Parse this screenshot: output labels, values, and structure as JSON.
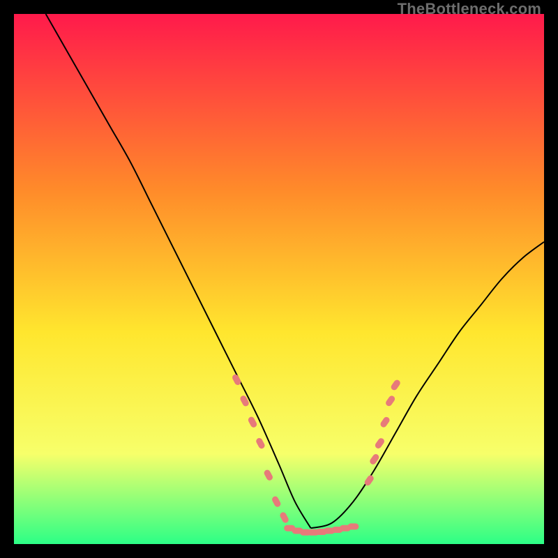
{
  "watermark": "TheBottleneck.com",
  "colors": {
    "gradient_top": "#ff1a4b",
    "gradient_mid1": "#ff8a2a",
    "gradient_mid2": "#ffe62e",
    "gradient_mid3": "#f7ff6a",
    "gradient_bottom": "#2cff86",
    "curve": "#000000",
    "scatter": "#e77a7a",
    "frame": "#000000"
  },
  "chart_data": {
    "type": "line",
    "title": "",
    "xlabel": "",
    "ylabel": "",
    "xlim": [
      0,
      100
    ],
    "ylim": [
      0,
      100
    ],
    "grid": false,
    "legend": false,
    "series": [
      {
        "name": "bottleneck-curve-left",
        "x": [
          6,
          10,
          14,
          18,
          22,
          26,
          30,
          34,
          38,
          42,
          46,
          50,
          53,
          56
        ],
        "values": [
          100,
          93,
          86,
          79,
          72,
          64,
          56,
          48,
          40,
          32,
          24,
          15,
          8,
          3
        ]
      },
      {
        "name": "bottleneck-curve-right",
        "x": [
          56,
          60,
          64,
          68,
          72,
          76,
          80,
          84,
          88,
          92,
          96,
          100
        ],
        "values": [
          3,
          4,
          8,
          14,
          21,
          28,
          34,
          40,
          45,
          50,
          54,
          57
        ]
      }
    ],
    "scatter": {
      "name": "optimal-range-markers",
      "points": [
        {
          "x": 42,
          "y": 31
        },
        {
          "x": 43.5,
          "y": 27
        },
        {
          "x": 45,
          "y": 23
        },
        {
          "x": 46.5,
          "y": 19
        },
        {
          "x": 48,
          "y": 13
        },
        {
          "x": 49.5,
          "y": 8
        },
        {
          "x": 51,
          "y": 5
        },
        {
          "x": 52,
          "y": 3
        },
        {
          "x": 53.5,
          "y": 2.5
        },
        {
          "x": 55,
          "y": 2.2
        },
        {
          "x": 56.5,
          "y": 2.2
        },
        {
          "x": 58,
          "y": 2.3
        },
        {
          "x": 59.5,
          "y": 2.5
        },
        {
          "x": 61,
          "y": 2.7
        },
        {
          "x": 62.5,
          "y": 3
        },
        {
          "x": 64,
          "y": 3.3
        },
        {
          "x": 67,
          "y": 12
        },
        {
          "x": 68,
          "y": 16
        },
        {
          "x": 69,
          "y": 19
        },
        {
          "x": 70,
          "y": 23
        },
        {
          "x": 71,
          "y": 27
        },
        {
          "x": 72,
          "y": 30
        }
      ]
    }
  }
}
